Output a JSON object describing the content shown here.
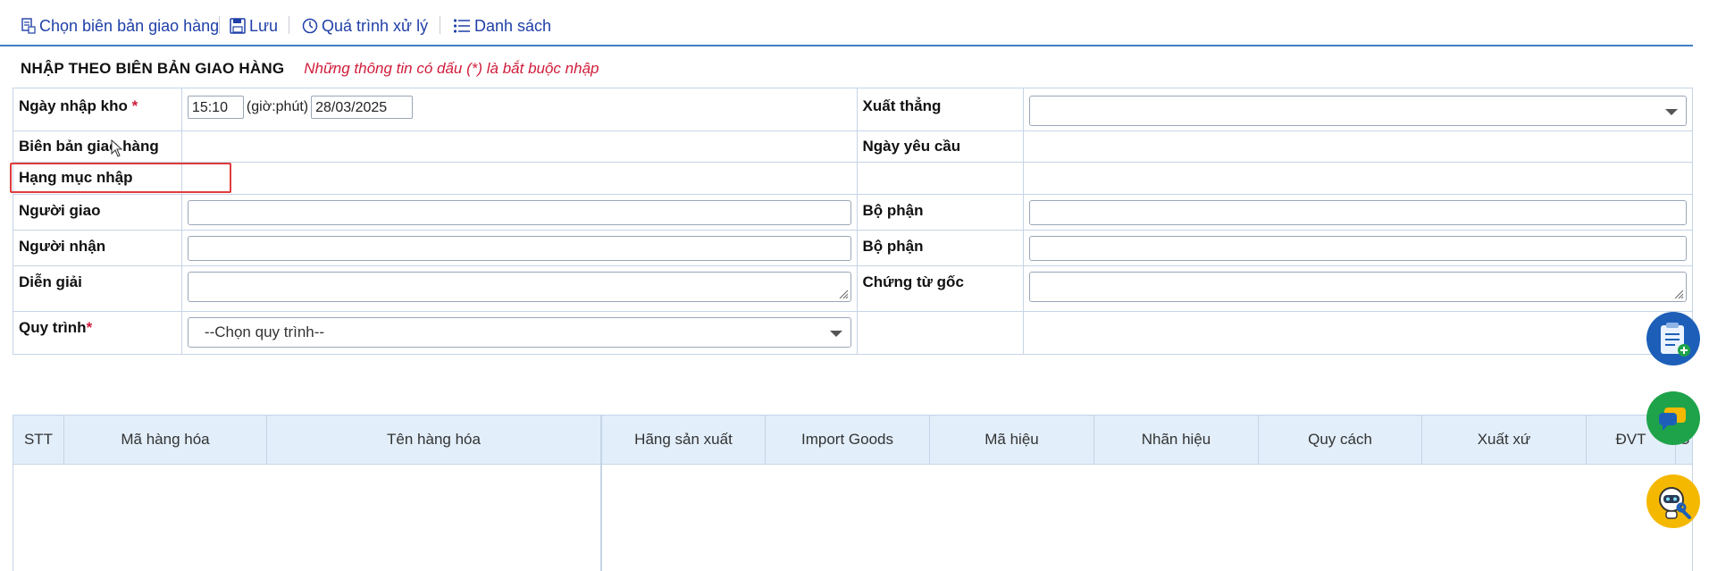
{
  "toolbar": {
    "choose_delivery": "Chọn biên bản giao hàng",
    "save": "Lưu",
    "process": "Quá trình xử lý",
    "list": "Danh sách"
  },
  "heading": {
    "title": "NHẬP THEO BIÊN BẢN GIAO HÀNG",
    "note": "Những thông tin có dấu (*) là bắt buộc nhập"
  },
  "form": {
    "import_date_label": "Ngày nhập kho",
    "required_mark": "*",
    "time_value": "15:10",
    "time_unit": "(giờ:phút)",
    "date_value": "28/03/2025",
    "direct_export_label": "Xuất thẳng",
    "delivery_record_label": "Biên bản giao hàng",
    "request_date_label": "Ngày yêu cầu",
    "import_category_label": "Hạng mục nhập",
    "deliverer_label": "Người giao",
    "deliverer_dept_label": "Bộ phận",
    "receiver_label": "Người nhận",
    "receiver_dept_label": "Bộ phận",
    "description_label": "Diễn giải",
    "original_doc_label": "Chứng từ gốc",
    "process_label": "Quy trình",
    "process_placeholder": "--Chọn quy trình--"
  },
  "grid": {
    "left_columns": [
      "STT",
      "Mã hàng hóa",
      "Tên hàng hóa"
    ],
    "right_columns": [
      "Hãng sản xuất",
      "Import Goods",
      "Mã hiệu",
      "Nhãn hiệu",
      "Quy cách",
      "Xuất xứ",
      "ĐVT",
      "S"
    ]
  },
  "floating": {
    "icons": [
      "clipboard-add-icon",
      "chat-icon",
      "robot-support-icon"
    ],
    "colors": {
      "clipboard": "#1d5fb8",
      "chat": "#1fa34a",
      "robot": "#f5b800"
    }
  }
}
